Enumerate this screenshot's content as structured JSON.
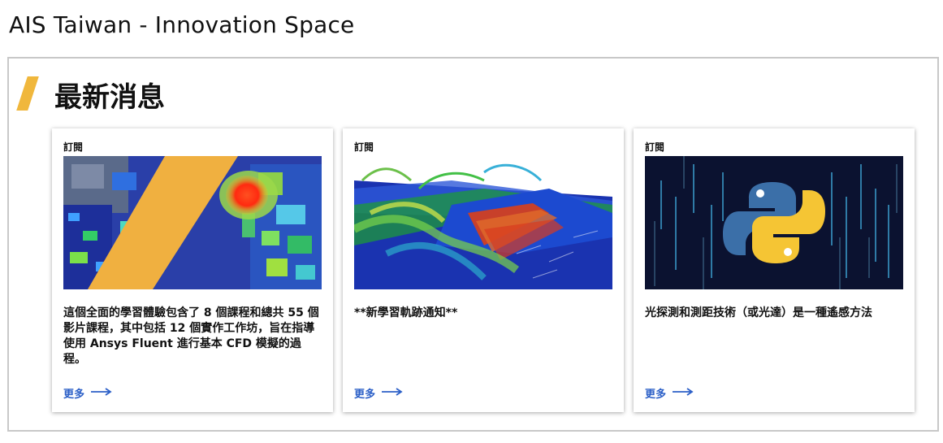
{
  "page": {
    "title": "AIS Taiwan - Innovation Space"
  },
  "section": {
    "title": "最新消息"
  },
  "colors": {
    "accent": "#f0b73c",
    "link": "#2b5fc7",
    "border": "#c8c8c8"
  },
  "cards": [
    {
      "tag": "訂閱",
      "image_icon": "cfd-simulation-image",
      "text": "這個全面的學習體驗包含了 8 個課程和總共 55 個影片課程，其中包括 12 個實作工作坊，旨在指導使用 Ansys Fluent 進行基本 CFD 模擬的過程。",
      "more": "更多"
    },
    {
      "tag": "訂閱",
      "image_icon": "flow-simulation-image",
      "text": "**新學習軌跡通知**",
      "more": "更多"
    },
    {
      "tag": "訂閱",
      "image_icon": "python-logo-image",
      "text": "光探測和測距技術（或光達）是一種遙感方法",
      "more": "更多"
    }
  ]
}
